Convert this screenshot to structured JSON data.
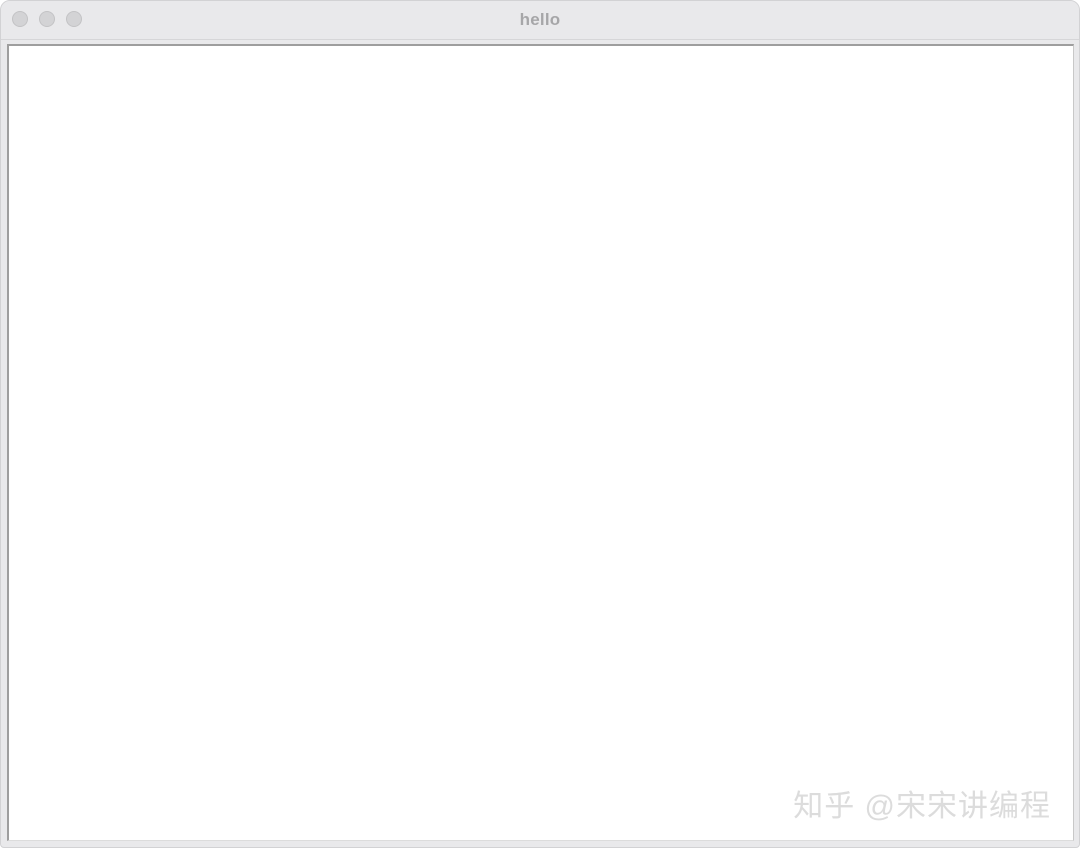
{
  "window": {
    "title": "hello",
    "controls": {
      "close": "close-button",
      "minimize": "minimize-button",
      "zoom": "zoom-button"
    }
  },
  "watermark": {
    "text": "知乎 @宋宋讲编程"
  }
}
